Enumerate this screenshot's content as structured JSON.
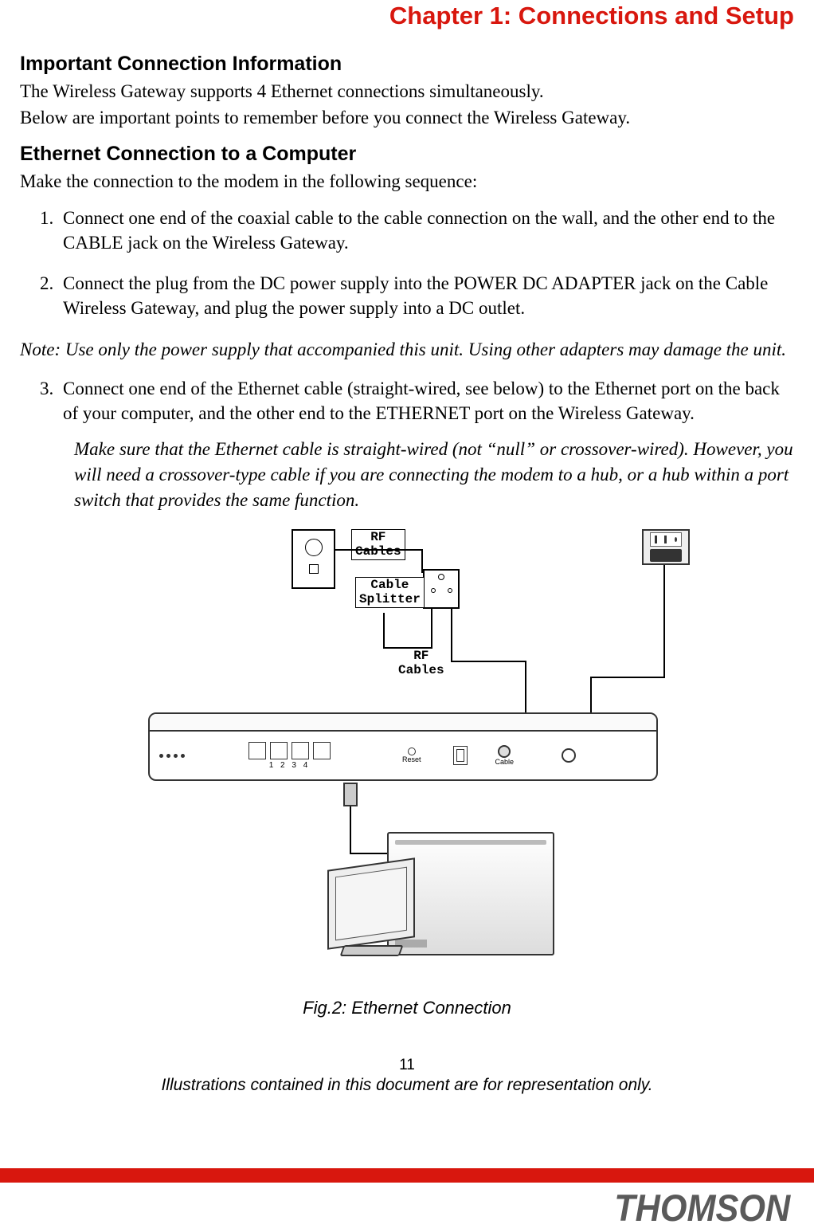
{
  "chapter_title": "Chapter 1: Connections and Setup",
  "section1": {
    "heading": "Important Connection Information",
    "p1": "The Wireless Gateway supports 4 Ethernet connections simultaneously.",
    "p2": "Below are important points to remember before you connect the Wireless Gateway."
  },
  "section2": {
    "heading": "Ethernet Connection to a Computer",
    "intro": "Make the connection to the modem in the following sequence:",
    "steps": [
      "Connect one end of the coaxial cable to the cable connection on the wall, and the other end to the CABLE jack on the Wireless Gateway.",
      "Connect the plug from the DC power supply into the POWER DC ADAPTER jack on the Cable Wireless Gateway, and plug the power supply into a DC outlet."
    ],
    "note": "Note: Use only the power supply that accompanied this unit. Using other adapters may damage the unit.",
    "step3": "Connect one end of the Ethernet cable (straight-wired, see below) to the Ethernet port on the back of your computer, and the other end to the ETHERNET port on the Wireless Gateway.",
    "step3_note": "Make sure that the Ethernet cable is straight-wired (not “null” or crossover-wired). However, you will need a crossover-type cable if you are connecting the modem to a hub, or a hub within a port switch that provides the same function."
  },
  "figure": {
    "labels": {
      "rf_cables_top": "RF\nCables",
      "cable_splitter": "Cable\nSplitter",
      "rf_cables_mid": "RF\nCables"
    },
    "gateway_ports": "1    2    3    4",
    "gateway_reset": "Reset",
    "gateway_cable": "Cable",
    "caption": "Fig.2: Ethernet Connection"
  },
  "page_number": "11",
  "disclaimer": "Illustrations contained in this document are for representation only.",
  "brand": "THOMSON"
}
